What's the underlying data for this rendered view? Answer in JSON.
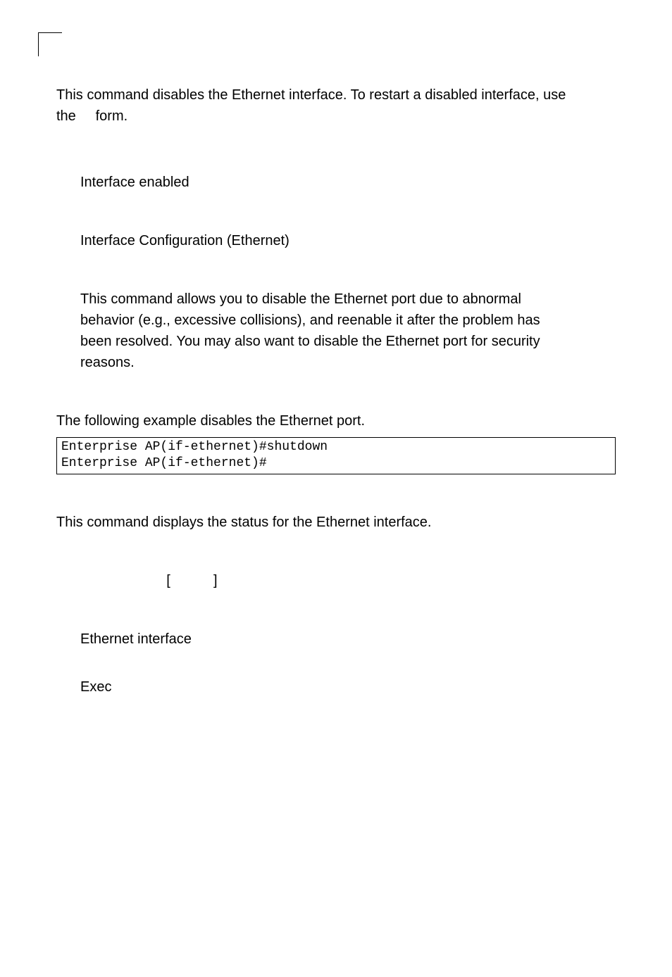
{
  "shutdown_cmd": {
    "intro_part1": "This command disables the Ethernet interface. To restart a disabled interface, use",
    "intro_part2a": "the",
    "intro_part2b": "form.",
    "default_heading": "Interface enabled",
    "mode": "Interface Configuration (Ethernet)",
    "usage1": "This command allows you to disable the Ethernet port due to abnormal",
    "usage2": "behavior (e.g., excessive collisions), and reenable it after the problem has",
    "usage3": "been resolved. You may also want to disable the Ethernet port for security",
    "usage4": "reasons.",
    "example_lead": "The following example disables the Ethernet port.",
    "code_line1": "Enterprise AP(if-ethernet)#shutdown",
    "code_line2": "Enterprise AP(if-ethernet)#"
  },
  "show_cmd": {
    "intro": "This command displays the status for the Ethernet interface.",
    "syntax_open": "[",
    "syntax_close": "]",
    "default": "Ethernet interface",
    "mode": "Exec"
  }
}
